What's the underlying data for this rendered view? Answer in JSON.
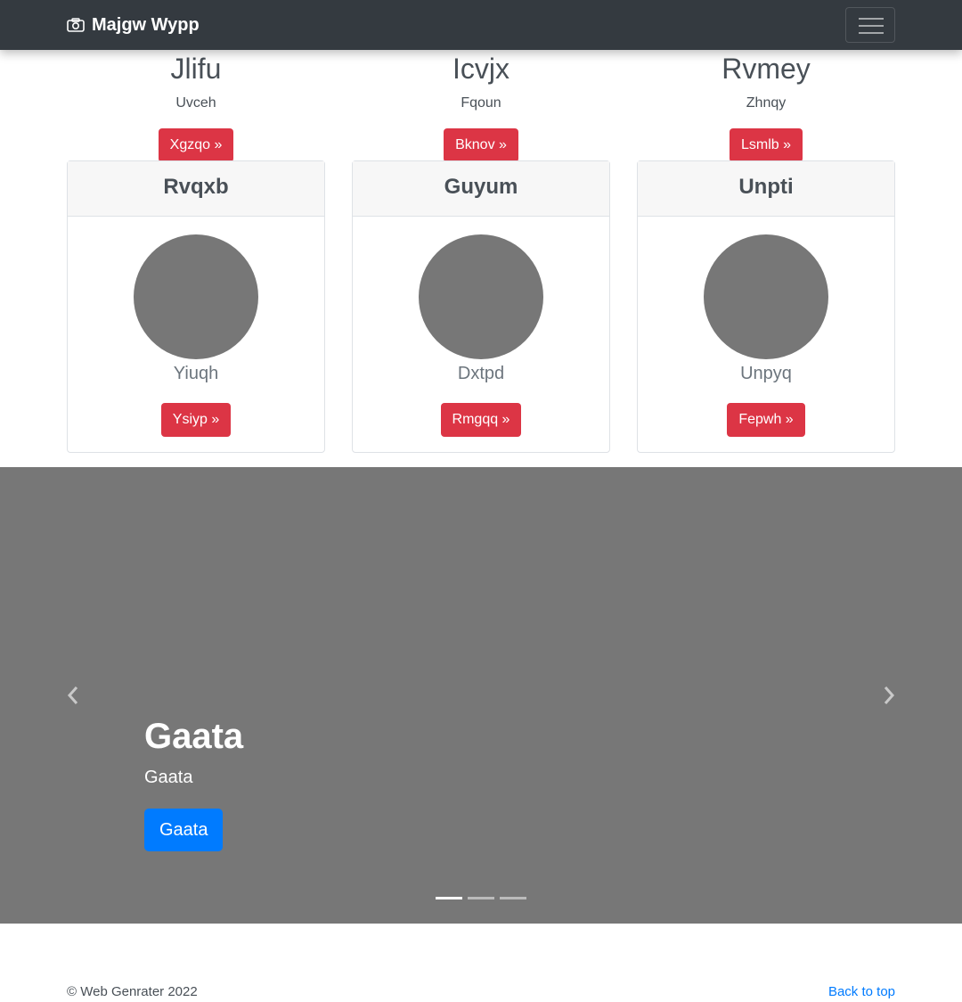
{
  "navbar": {
    "brand": "Majgw Wypp",
    "brand_icon": "camera-icon",
    "toggler_icon": "hamburger-icon"
  },
  "columns": [
    {
      "title": "Jlifu",
      "subtitle": "Uvceh",
      "button": "Xgzqo »"
    },
    {
      "title": "Icvjx",
      "subtitle": "Fqoun",
      "button": "Bknov »"
    },
    {
      "title": "Rvmey",
      "subtitle": "Zhnqy",
      "button": "Lsmlb »"
    }
  ],
  "cards": [
    {
      "header": "Rvqxb",
      "subtitle": "Yiuqh",
      "button": "Ysiyp »"
    },
    {
      "header": "Guyum",
      "subtitle": "Dxtpd",
      "button": "Rmgqq »"
    },
    {
      "header": "Unpti",
      "subtitle": "Unpyq",
      "button": "Fepwh »"
    }
  ],
  "carousel": {
    "heading": "Gaata",
    "text": "Gaata",
    "button": "Gaata",
    "prev_icon": "chevron-left-icon",
    "next_icon": "chevron-right-icon",
    "slide_count": 3,
    "active_slide": 1
  },
  "footer": {
    "copyright": "© Web Genrater 2022",
    "back_to_top": "Back to top"
  },
  "colors": {
    "navbar": "#343a40",
    "danger": "#dc3545",
    "primary": "#007bff",
    "placeholder": "#777777"
  }
}
